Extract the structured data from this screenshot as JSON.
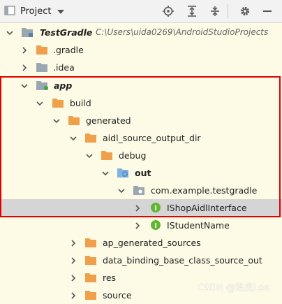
{
  "toolbar": {
    "title": "Project",
    "icons": [
      "project-view-icon",
      "dropdown-caret-icon",
      "locate-icon",
      "expand-all-icon",
      "collapse-all-icon",
      "gear-icon",
      "minimize-icon"
    ]
  },
  "tree": {
    "root": {
      "label": "TestGradle",
      "path": "C:\\Users\\uida0269\\AndroidStudioProjects"
    },
    "gradle": {
      "label": ".gradle"
    },
    "idea": {
      "label": ".idea"
    },
    "app": {
      "label": "app"
    },
    "build": {
      "label": "build"
    },
    "generated": {
      "label": "generated"
    },
    "aidl": {
      "label": "aidl_source_output_dir"
    },
    "debug": {
      "label": "debug"
    },
    "out": {
      "label": "out"
    },
    "package": {
      "label": "com.example.testgradle"
    },
    "ishop": {
      "label": "IShopAidlInterface",
      "badge": "I"
    },
    "istudent": {
      "label": "IStudentName",
      "badge": "I"
    },
    "ap_generated": {
      "label": "ap_generated_sources"
    },
    "data_binding": {
      "label": "data_binding_base_class_source_out"
    },
    "res": {
      "label": "res"
    },
    "source": {
      "label": "source"
    }
  },
  "colors": {
    "folder_orange": "#f0a04b",
    "folder_gray": "#9aa7b0",
    "interface_green": "#5fb832",
    "highlight_red": "#e00000",
    "selection": "#d5d5d5"
  },
  "watermark": "CSDN @洛克Lee"
}
